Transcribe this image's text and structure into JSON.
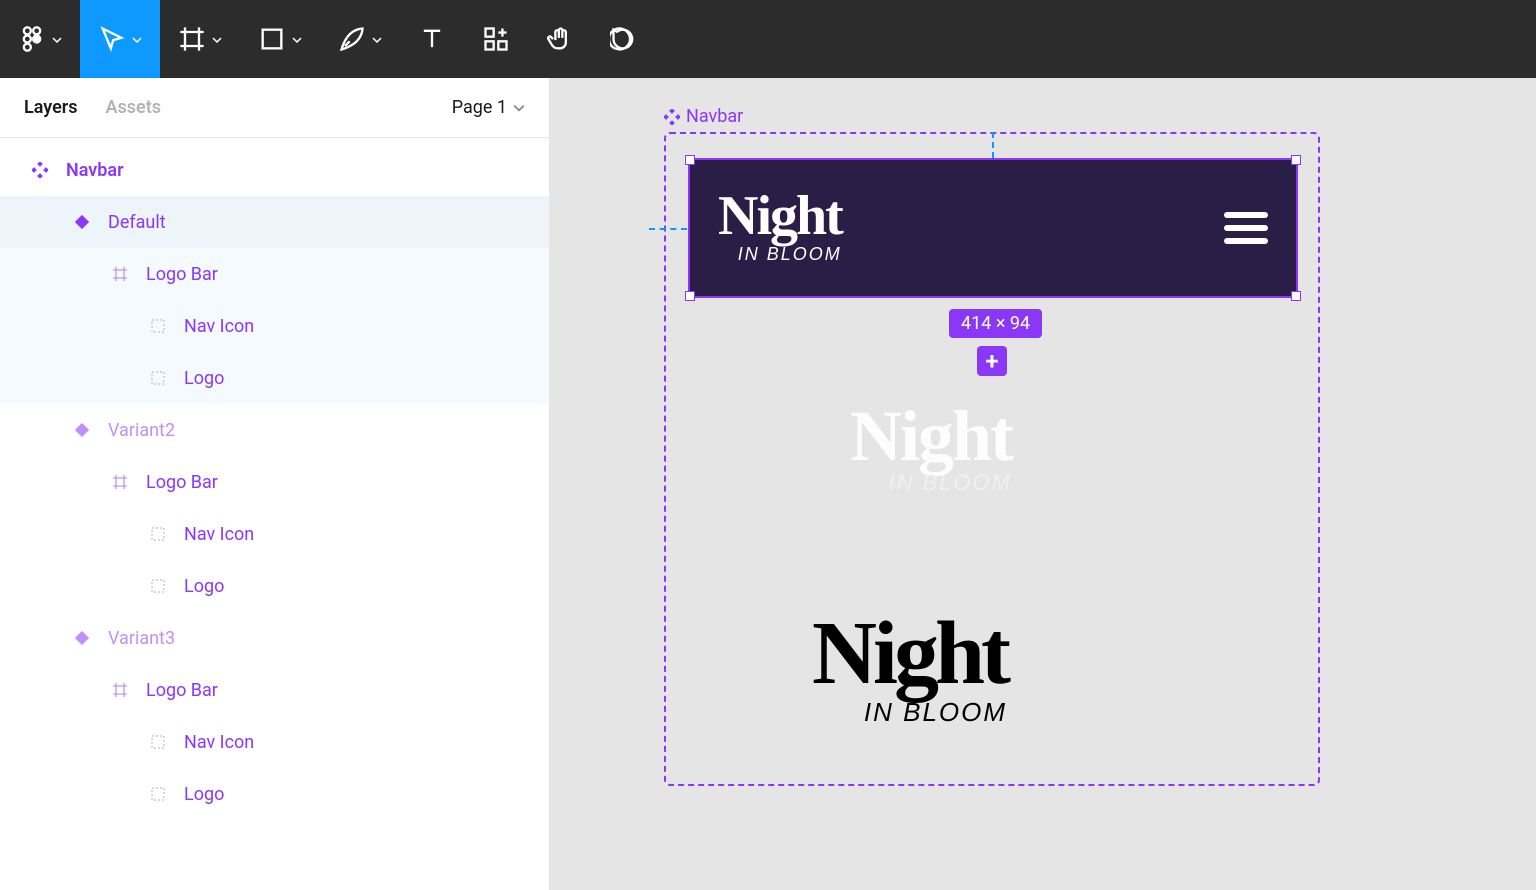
{
  "panel": {
    "tabs": {
      "layers": "Layers",
      "assets": "Assets"
    },
    "page_label": "Page 1"
  },
  "layers": [
    {
      "name": "Navbar",
      "depth": 0,
      "icon": "component-set",
      "state": ""
    },
    {
      "name": "Default",
      "depth": 1,
      "icon": "variant",
      "state": "selected"
    },
    {
      "name": "Logo Bar",
      "depth": 2,
      "icon": "frame",
      "state": "highlight"
    },
    {
      "name": "Nav Icon",
      "depth": 3,
      "icon": "group",
      "state": "highlight"
    },
    {
      "name": "Logo",
      "depth": 3,
      "icon": "group",
      "state": "highlight"
    },
    {
      "name": "Variant2",
      "depth": 1,
      "icon": "variant",
      "state": ""
    },
    {
      "name": "Logo Bar",
      "depth": 2,
      "icon": "frame",
      "state": ""
    },
    {
      "name": "Nav Icon",
      "depth": 3,
      "icon": "group",
      "state": ""
    },
    {
      "name": "Logo",
      "depth": 3,
      "icon": "group",
      "state": ""
    },
    {
      "name": "Variant3",
      "depth": 1,
      "icon": "variant",
      "state": ""
    },
    {
      "name": "Logo Bar",
      "depth": 2,
      "icon": "frame",
      "state": ""
    },
    {
      "name": "Nav Icon",
      "depth": 3,
      "icon": "group",
      "state": ""
    },
    {
      "name": "Logo",
      "depth": 3,
      "icon": "group",
      "state": ""
    }
  ],
  "canvas": {
    "component_label": "Navbar",
    "dimensions_badge": "414 × 94",
    "logo_main": "Night",
    "logo_sub": "IN BLOOM"
  }
}
